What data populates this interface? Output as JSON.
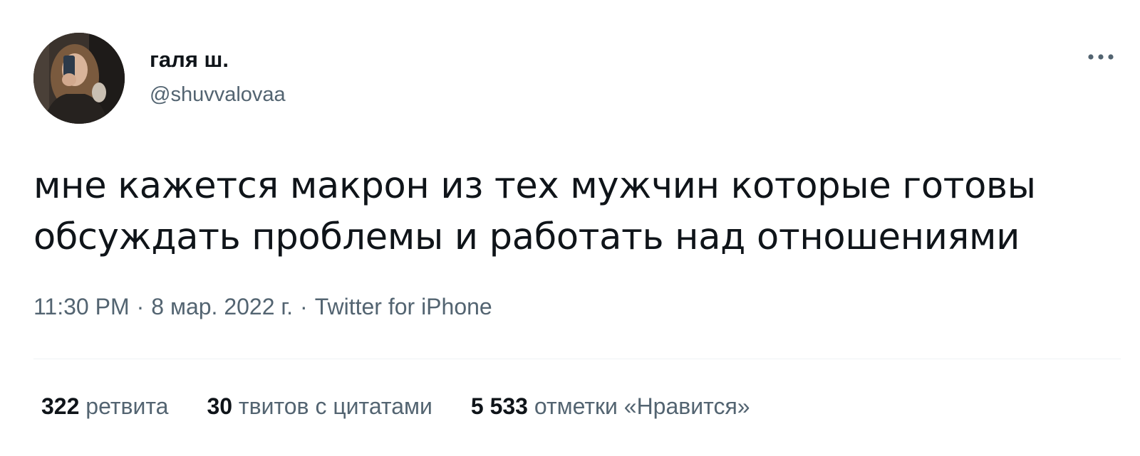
{
  "author": {
    "display_name": "галя ш.",
    "handle": "@shuvvalovaa"
  },
  "icons": {
    "avatar": "profile-photo",
    "more": "more-horizontal-icon"
  },
  "tweet": {
    "text": "мне кажется макрон из тех мужчин которые готовы обсуждать проблемы и работать над отношениями"
  },
  "meta": {
    "time": "11:30 PM",
    "separator": "·",
    "date": "8 мар. 2022 г.",
    "source": "Twitter for iPhone"
  },
  "stats": {
    "retweets": {
      "count": "322",
      "label": "ретвита"
    },
    "quotes": {
      "count": "30",
      "label": "твитов с цитатами"
    },
    "likes": {
      "count": "5 533",
      "label": "отметки «Нравится»"
    }
  },
  "colors": {
    "primary_text": "#0f1419",
    "secondary_text": "#536471",
    "divider": "#eff3f4",
    "background": "#ffffff"
  }
}
